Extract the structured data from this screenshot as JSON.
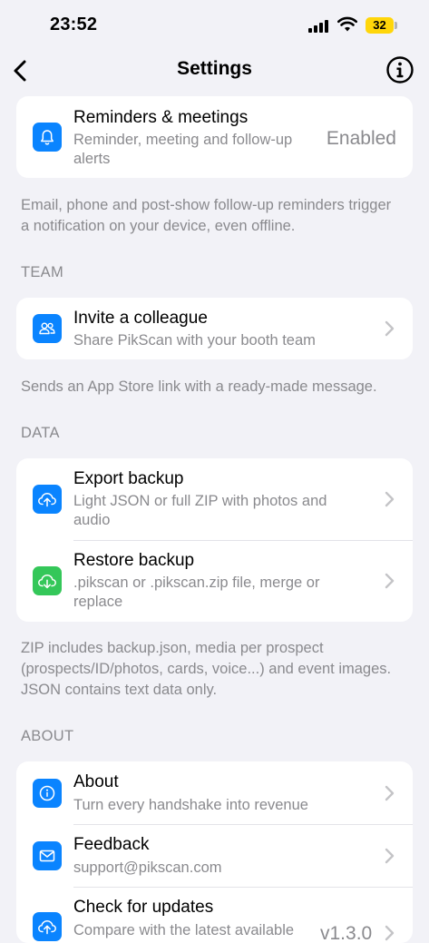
{
  "status_bar": {
    "time": "23:52",
    "battery": "32"
  },
  "nav": {
    "title": "Settings",
    "back_icon": "chevron-left-icon",
    "info_icon": "info-circle-icon"
  },
  "notifications": {
    "reminders": {
      "title": "Reminders & meetings",
      "subtitle": "Reminder, meeting and follow-up alerts",
      "value": "Enabled",
      "icon": "bell-icon"
    },
    "footnote": "Email, phone and post-show follow-up reminders trigger a notification on your device, even offline."
  },
  "team": {
    "header": "TEAM",
    "invite": {
      "title": "Invite a colleague",
      "subtitle": "Share PikScan with your booth team",
      "icon": "people-icon"
    },
    "footnote": "Sends an App Store link with a ready-made message."
  },
  "data": {
    "header": "DATA",
    "export": {
      "title": "Export backup",
      "subtitle": "Light JSON or full ZIP with photos and audio",
      "icon": "cloud-upload-icon"
    },
    "restore": {
      "title": "Restore backup",
      "subtitle": ".pikscan or .pikscan.zip file, merge or replace",
      "icon": "cloud-download-icon"
    },
    "footnote": "ZIP includes backup.json, media per prospect (prospects/ID/photos, cards, voice...) and event images. JSON contains text data only."
  },
  "about": {
    "header": "ABOUT",
    "about_item": {
      "title": "About",
      "subtitle": "Turn every handshake into revenue",
      "icon": "info-icon"
    },
    "feedback": {
      "title": "Feedback",
      "subtitle": "support@pikscan.com",
      "icon": "envelope-icon"
    },
    "updates": {
      "title": "Check for updates",
      "subtitle": "Compare with the latest available",
      "value": "v1.3.0",
      "icon": "cloud-upload-icon"
    }
  },
  "colors": {
    "accent": "#0a84ff",
    "green": "#34c759",
    "background": "#f2f2f7",
    "secondary_text": "#8a8a8e",
    "battery": "#ffd60a"
  }
}
